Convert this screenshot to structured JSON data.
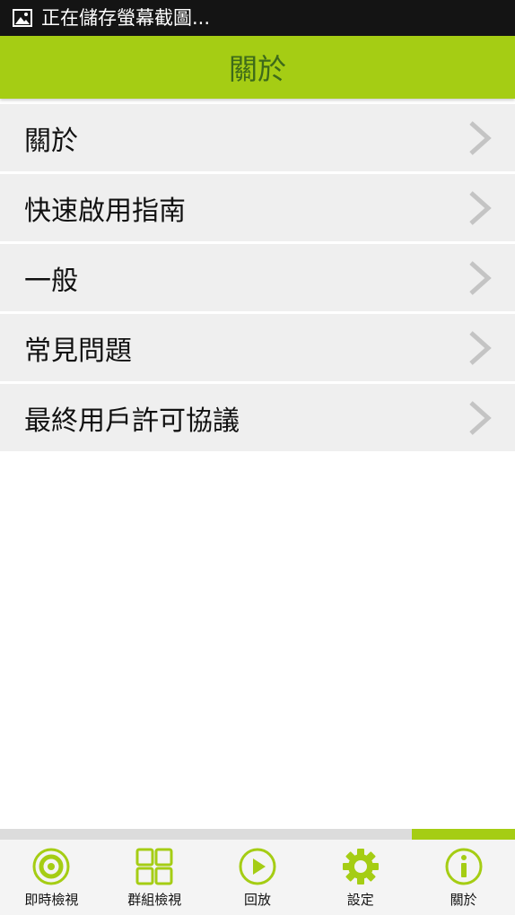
{
  "status_bar": {
    "icon": "image-icon",
    "text": "正在儲存螢幕截圖..."
  },
  "header": {
    "title": "關於"
  },
  "menu": {
    "items": [
      {
        "label": "關於"
      },
      {
        "label": "快速啟用指南"
      },
      {
        "label": "一般"
      },
      {
        "label": "常見問題"
      },
      {
        "label": "最終用戶許可協議"
      }
    ]
  },
  "tab_bar": {
    "active_index": 4,
    "tabs": [
      {
        "label": "即時檢視",
        "icon": "live-view-icon"
      },
      {
        "label": "群組檢視",
        "icon": "grid-icon"
      },
      {
        "label": "回放",
        "icon": "play-icon"
      },
      {
        "label": "設定",
        "icon": "gear-icon"
      },
      {
        "label": "關於",
        "icon": "info-icon"
      }
    ]
  },
  "colors": {
    "accent": "#a5cd14",
    "title_text": "#3d6a1a",
    "status_bar": "#141414",
    "menu_item_bg": "#efefef",
    "chevron": "#c4c4c4"
  }
}
